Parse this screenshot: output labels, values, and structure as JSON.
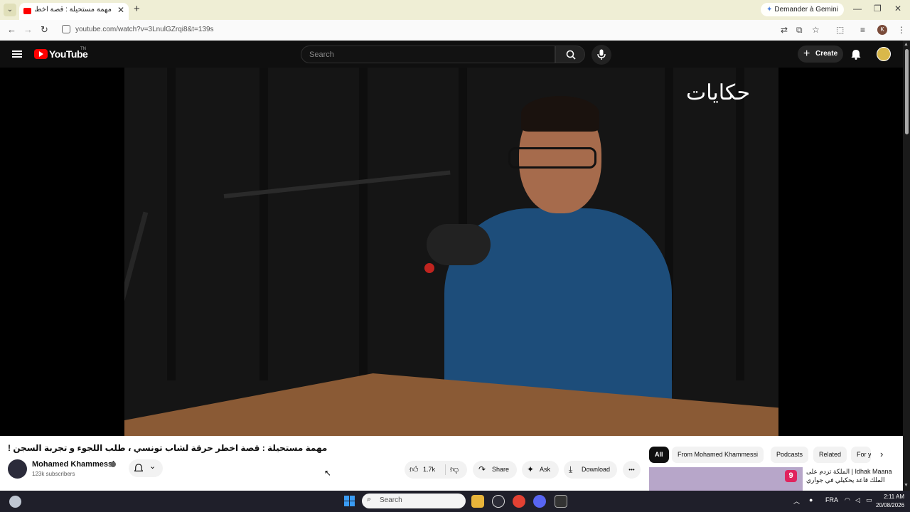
{
  "browser": {
    "tab_title": "مهمة مستحيلة : قصة اخطر",
    "tab_close": "✕",
    "new_tab": "+",
    "gemini_button": "Demander à Gemini",
    "url": "youtube.com/watch?v=3LnulGZrqi8&t=139s",
    "window_controls": [
      "—",
      "❐",
      "✕"
    ]
  },
  "youtube": {
    "logo_text": "YouTube",
    "logo_tm": "TN",
    "search_placeholder": "Search",
    "create_label": "Create",
    "watermark": "حكايات"
  },
  "video": {
    "title": "مهمة مستحيلة : قصة اخطر حرقة لشاب تونسي ، طلب اللجوء و تجربة السجن !",
    "channel_name": "Mohamed Khammessi",
    "subscribers": "123k subscribers",
    "like_count": "1.7k",
    "share_label": "Share",
    "ask_label": "Ask",
    "download_label": "Download",
    "more_label": "•••"
  },
  "sidebar": {
    "chips": [
      "All",
      "From Mohamed Khammessi",
      "Podcasts",
      "Related",
      "For y"
    ],
    "recommendation": {
      "number": "9",
      "title": "Idhak Maana | الملكة تزدم على الملك قاعد يحكيلي في جواري"
    }
  },
  "taskbar": {
    "search_label": "Search",
    "language": "FRA",
    "time": "2:11 AM",
    "date": "20/08/2026"
  },
  "colors": {
    "youtube_red": "#ff0000",
    "tab_strip": "#efeed5",
    "page_bg": "#0f0f0f"
  }
}
